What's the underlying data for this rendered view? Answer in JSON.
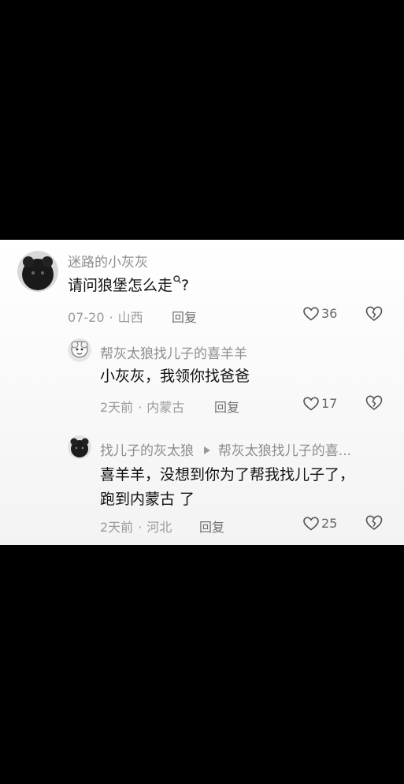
{
  "comments": [
    {
      "author": "迷路的小灰灰",
      "text": "请问狼堡怎么走",
      "date": "07-20",
      "location": "山西",
      "reply_label": "回复",
      "likes": "36",
      "icons": [
        "avatar-dark",
        "search-icon",
        "heart-icon",
        "broken-heart-icon"
      ]
    },
    {
      "author": "帮灰太狼找儿子的喜羊羊",
      "text": "小灰灰，我领你找爸爸",
      "date": "2天前",
      "location": "内蒙古",
      "reply_label": "回复",
      "likes": "17"
    },
    {
      "author": "找儿子的灰太狼",
      "reply_to": "帮灰太狼找儿子的喜...",
      "text_line1": "喜羊羊，没想到你为了帮我找儿子了，",
      "text_line2": "跑到内蒙古 了",
      "date": "2天前",
      "location": "河北",
      "reply_label": "回复",
      "likes": "25"
    }
  ],
  "question_mark": "?",
  "dot": "·",
  "colors": {
    "background": "#000000",
    "card": "#ffffff",
    "muted": "#8e8e8e",
    "text": "#111111"
  }
}
